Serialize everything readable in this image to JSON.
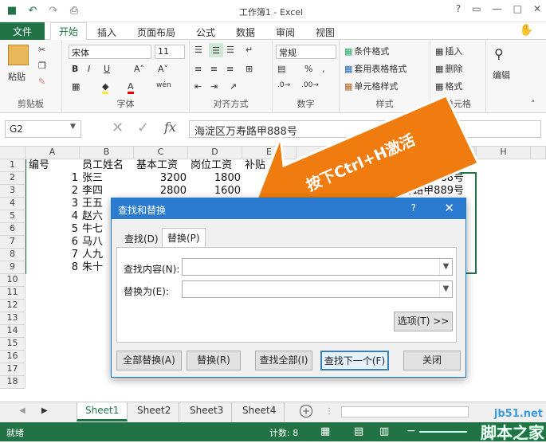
{
  "app_title": "工作簿1 - Excel",
  "window_controls": [
    "?",
    "▭",
    "—",
    "□",
    "✕"
  ],
  "qat": {
    "save": "save-icon",
    "undo": "↶",
    "redo": "↷",
    "preview": "⎙"
  },
  "tabs": {
    "file": "文件",
    "items": [
      "开始",
      "插入",
      "页面布局",
      "公式",
      "数据",
      "审阅",
      "视图"
    ]
  },
  "ribbon": {
    "clipboard": {
      "paste": "粘贴",
      "label": "剪贴板"
    },
    "font": {
      "name": "宋体",
      "size": "11",
      "bold": "B",
      "italic": "I",
      "underline": "U",
      "grow": "A˄",
      "shrink": "A˅",
      "wen": "wén",
      "label": "字体"
    },
    "alignment": {
      "label": "对齐方式"
    },
    "number": {
      "format": "常规",
      "percent": "%",
      "comma": ",",
      "label": "数字"
    },
    "styles": {
      "cond": "条件格式",
      "table": "套用表格格式",
      "cell": "单元格样式",
      "label": "样式"
    },
    "cells": {
      "insert": "插入",
      "delete": "删除",
      "format": "格式",
      "label": "单元格"
    },
    "editing": {
      "label": "编辑"
    }
  },
  "namebox": "G2",
  "formula_value": "海淀区万寿路甲888号",
  "columns": [
    "A",
    "B",
    "C",
    "D",
    "E",
    "F",
    "G",
    "H"
  ],
  "rows": [
    "1",
    "2",
    "3",
    "4",
    "5",
    "6",
    "7",
    "8",
    "9",
    "10",
    "11",
    "12",
    "13",
    "14",
    "15",
    "16",
    "17",
    "18"
  ],
  "headers": [
    "编号",
    "员工姓名",
    "基本工资",
    "岗位工资",
    "补贴"
  ],
  "data": [
    {
      "id": "1",
      "name": "张三",
      "base": "3200",
      "post": "1800"
    },
    {
      "id": "2",
      "name": "李四",
      "base": "2800",
      "post": "1600"
    },
    {
      "id": "3",
      "name": "王五"
    },
    {
      "id": "4",
      "name": "赵六"
    },
    {
      "id": "5",
      "name": "牛七"
    },
    {
      "id": "6",
      "name": "马八"
    },
    {
      "id": "7",
      "name": "人九"
    },
    {
      "id": "8",
      "name": "朱十"
    }
  ],
  "g_col": [
    "888号",
    "万寿路甲889号"
  ],
  "callout": "按下Ctrl+H激活",
  "dialog": {
    "title": "查找和替换",
    "help": "?",
    "close": "✕",
    "tab_find": "查找(D)",
    "tab_replace": "替换(P)",
    "find_label": "查找内容(N):",
    "replace_label": "替换为(E):",
    "options": "选项(T) >>",
    "buttons": [
      "全部替换(A)",
      "替换(R)",
      "查找全部(I)",
      "查找下一个(F)",
      "关闭"
    ]
  },
  "sheets": [
    "Sheet1",
    "Sheet2",
    "Sheet3",
    "Sheet4"
  ],
  "status": {
    "ready": "就绪",
    "count": "计数: 8"
  },
  "watermark": {
    "site": "jb51.net",
    "name": "脚本之家"
  },
  "colors": {
    "excel_green": "#217346",
    "dialog_blue": "#2b7bd0",
    "arrow_orange": "#f07c10"
  }
}
